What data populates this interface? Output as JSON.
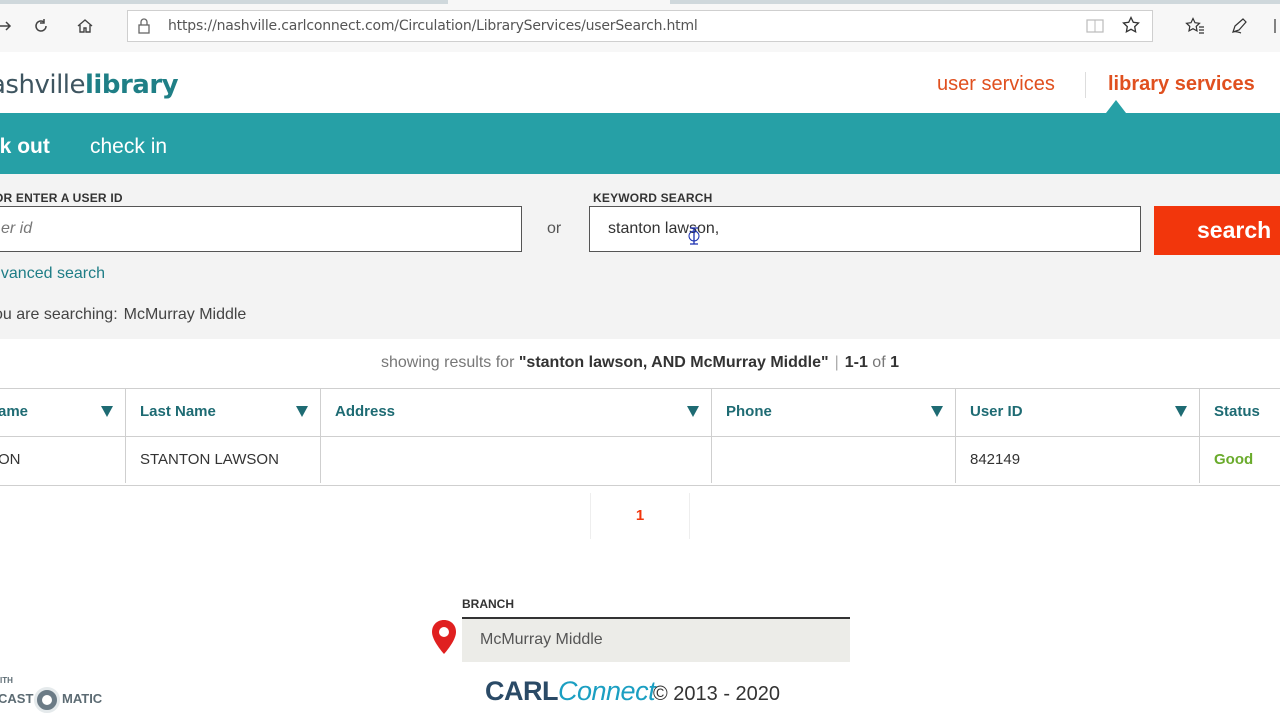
{
  "browser": {
    "url": "https://nashville.carlconnect.com/Circulation/LibraryServices/userSearch.html"
  },
  "header": {
    "logo_part1": "ashville",
    "logo_part2": "library",
    "nav_user": "user services",
    "nav_library": "library services"
  },
  "subnav": {
    "checkout": "ck out",
    "checkin": "check in"
  },
  "search": {
    "userid_label": "OR ENTER A USER ID",
    "userid_placeholder": "er id",
    "or_text": "or",
    "keyword_label": "KEYWORD SEARCH",
    "keyword_value": "stanton lawson,",
    "search_button": "search",
    "advanced_link": "dvanced search",
    "searching_prefix": "ou are searching:",
    "searching_branch": "McMurray Middle"
  },
  "results": {
    "showing_prefix": "showing results for",
    "query": "\"stanton lawson, AND McMurray Middle\"",
    "range": "1-1",
    "of": "of",
    "total": "1"
  },
  "table": {
    "headers": {
      "first_name": "ame",
      "last_name": "Last Name",
      "address": "Address",
      "phone": "Phone",
      "user_id": "User ID",
      "status": "Status"
    },
    "rows": [
      {
        "first_name": "ON",
        "last_name": "STANTON LAWSON",
        "address": "",
        "phone": "",
        "user_id": "842149",
        "status": "Good"
      }
    ]
  },
  "pager": {
    "current": "1"
  },
  "branch": {
    "label": "BRANCH",
    "value": "McMurray Middle"
  },
  "footer": {
    "brand_a": "CARL",
    "brand_b": "Connect",
    "copyright": "© 2013 - 2020"
  },
  "watermark": {
    "top": "ITH",
    "text_a": "CAST",
    "text_b": "MATIC"
  },
  "colors": {
    "teal": "#26a0a6",
    "orange": "#e0501f",
    "search_red": "#f2360c",
    "status_good": "#6aab2c"
  }
}
